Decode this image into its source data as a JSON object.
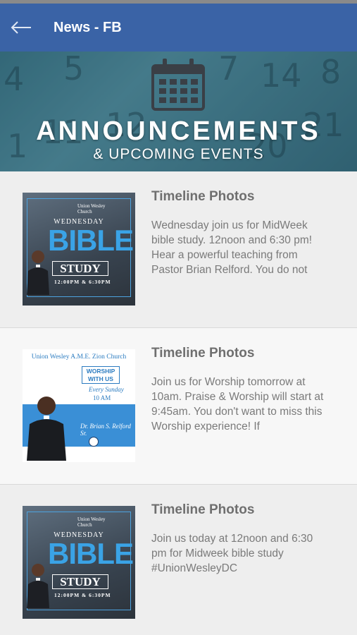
{
  "app_bar": {
    "title": "News - FB",
    "back_icon": "arrow-left-icon",
    "color": "#3a63a6"
  },
  "banner": {
    "title": "ANNOUNCEMENTS",
    "subtitle": "& UPCOMING EVENTS",
    "icon": "calendar-icon"
  },
  "feed": [
    {
      "title": "Timeline Photos",
      "text": "Wednesday join us for MidWeek bible study. 12noon and 6:30 pm! Hear a powerful teaching from Pastor Brian Relford. You do not",
      "thumb": {
        "church_line1": "Union Wesley",
        "church_line2": "Church",
        "heading": "WEDNESDAY",
        "big": "BIBLE",
        "boxed": "STUDY",
        "time": "12:00PM & 6:30PM"
      }
    },
    {
      "title": "Timeline Photos",
      "text": "Join us for Worship tomorrow at 10am. Praise & Worship will start at 9:45am. You don't want to miss this Worship experience! If",
      "thumb": {
        "church": "Union Wesley A.M.E. Zion Church",
        "box_line1": "WORSHIP",
        "box_line2": "WITH US",
        "every": "Every Sunday",
        "time": "10 AM",
        "signature": "Dr. Brian S. Relford Sr."
      }
    },
    {
      "title": "Timeline Photos",
      "text": "Join us today at 12noon and 6:30 pm for Midweek bible study #UnionWesleyDC",
      "thumb": {
        "church_line1": "Union Wesley",
        "church_line2": "Church",
        "heading": "WEDNESDAY",
        "big": "BIBLE",
        "boxed": "STUDY",
        "time": "12:00PM & 6:30PM"
      }
    }
  ]
}
